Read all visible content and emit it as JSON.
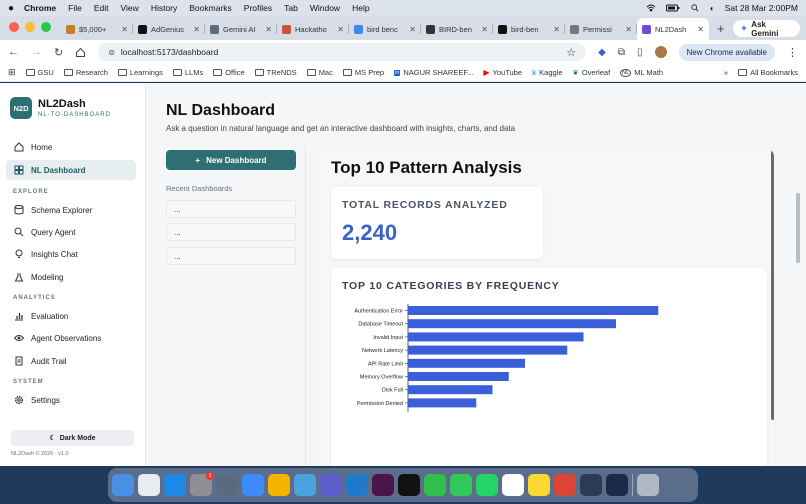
{
  "menubar": {
    "items": [
      "Chrome",
      "File",
      "Edit",
      "View",
      "History",
      "Bookmarks",
      "Profiles",
      "Tab",
      "Window",
      "Help"
    ],
    "datetime": "Sat 28 Mar  2:00PM"
  },
  "tabs": [
    {
      "label": "$5,000+",
      "color": "#c77d2b"
    },
    {
      "label": "AdGenius",
      "color": "#111111"
    },
    {
      "label": "Gemini AI",
      "color": "#5f6b7a"
    },
    {
      "label": "Hackatho",
      "color": "#c9553b"
    },
    {
      "label": "bird benc",
      "color": "#4285f4"
    },
    {
      "label": "BIRD-ben",
      "color": "#333333"
    },
    {
      "label": "bird-ben",
      "color": "#111111"
    },
    {
      "label": "Permissi",
      "color": "#777777"
    },
    {
      "label": "NL2Dash",
      "color": "#6d4ad8",
      "active": true
    }
  ],
  "ask_gemini": "Ask Gemini",
  "address": {
    "url": "localhost:5173/dashboard",
    "new_chrome": "New Chrome available"
  },
  "bookmarks": [
    {
      "label": "GSU",
      "type": "folder"
    },
    {
      "label": "Research",
      "type": "folder"
    },
    {
      "label": "Learnings",
      "type": "folder"
    },
    {
      "label": "LLMs",
      "type": "folder"
    },
    {
      "label": "Office",
      "type": "folder"
    },
    {
      "label": "TReNDS",
      "type": "folder"
    },
    {
      "label": "Mac",
      "type": "folder"
    },
    {
      "label": "MS Prep",
      "type": "folder"
    },
    {
      "label": "NAGUR SHAREEF...",
      "type": "linkedin"
    },
    {
      "label": "YouTube",
      "type": "youtube"
    },
    {
      "label": "Kaggle",
      "type": "kaggle"
    },
    {
      "label": "Overleaf",
      "type": "overleaf"
    },
    {
      "label": "ML Math",
      "type": "nl"
    }
  ],
  "all_bookmarks": "All Bookmarks",
  "sidebar": {
    "logo": "N2D",
    "name": "NL2Dash",
    "sub": "NL-TO-DASHBOARD",
    "sections": {
      "explore": "EXPLORE",
      "analytics": "ANALYTICS",
      "system": "SYSTEM"
    },
    "items": {
      "home": "Home",
      "nl_dashboard": "NL Dashboard",
      "schema_explorer": "Schema Explorer",
      "query_agent": "Query Agent",
      "insights_chat": "Insights Chat",
      "modeling": "Modeling",
      "evaluation": "Evaluation",
      "agent_observations": "Agent Observations",
      "audit_trail": "Audit Trail",
      "settings": "Settings"
    },
    "dark_mode": "Dark Mode",
    "footer": "NL2Dash © 2026 · v1.0"
  },
  "main": {
    "title": "NL Dashboard",
    "subtitle": "Ask a question in natural language and get an interactive dashboard with insights, charts, and data",
    "new_dashboard": "New Dashboard",
    "recent_heading": "Recent Dashboards",
    "recent": [
      "...",
      "...",
      "..."
    ]
  },
  "panel": {
    "title": "Top 10 Pattern Analysis",
    "kpi_label": "TOTAL RECORDS ANALYZED",
    "kpi_value": "2,240",
    "chart_title": "TOP 10 CATEGORIES BY FREQUENCY"
  },
  "chart_data": {
    "type": "bar",
    "orientation": "horizontal",
    "title": "TOP 10 CATEGORIES BY FREQUENCY",
    "categories": [
      "Authentication Error",
      "Database Timeout",
      "Invalid Input",
      "Network Latency",
      "API Rate Limit",
      "Memory Overflow",
      "Disk Full",
      "Permission Denied"
    ],
    "values": [
      385,
      320,
      270,
      245,
      180,
      155,
      130,
      105
    ],
    "xlim": [
      0,
      400
    ],
    "color": "#3a5fd8"
  },
  "colors": {
    "accent": "#2f6f73",
    "kpi": "#3a63c8"
  }
}
